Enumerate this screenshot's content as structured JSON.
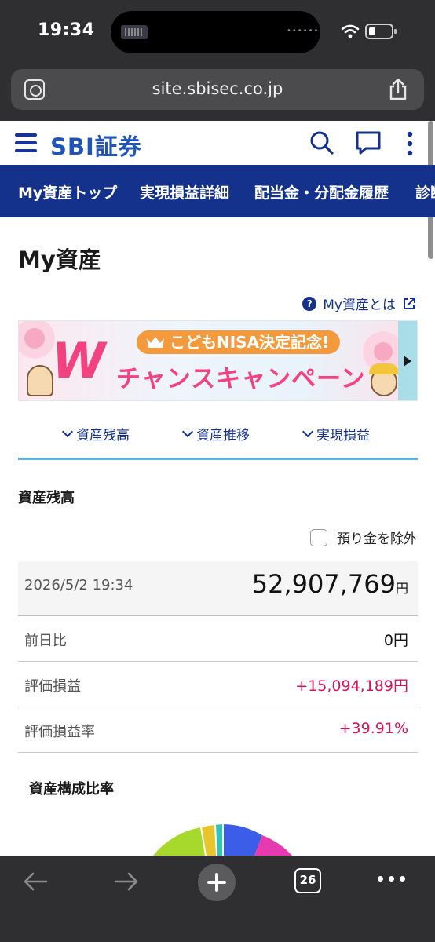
{
  "status": {
    "time": "19:34"
  },
  "browser": {
    "url": "site.sbisec.co.jp",
    "tab_count": "26"
  },
  "header": {
    "logo": "SBI証券"
  },
  "nav": {
    "tabs": [
      "My資産トップ",
      "実現損益詳細",
      "配当金・分配金履歴",
      "診断"
    ]
  },
  "page": {
    "title": "My資産",
    "help_link": "My資産とは"
  },
  "banner": {
    "w_letter": "W",
    "subtitle": "こどもNISA決定記念!",
    "main": "チャンスキャンペーン"
  },
  "anchors": [
    "資産残高",
    "資産推移",
    "実現損益"
  ],
  "balance": {
    "section_title": "資産残高",
    "exclude_label": "預り金を除外",
    "timestamp": "2026/5/2 19:34",
    "total": "52,907,769",
    "total_unit": "円",
    "rows": [
      {
        "label": "前日比",
        "value": "0円"
      },
      {
        "label": "評価損益",
        "value": "+15,094,189円"
      },
      {
        "label": "評価損益率",
        "value": "+39.91%"
      }
    ]
  },
  "composition": {
    "title": "資産構成比率",
    "colors": {
      "blue": "#3b5de7",
      "magenta": "#e83ab0",
      "green": "#a6d92c",
      "yellow": "#e8c52a",
      "teal": "#2fc4b8"
    }
  },
  "colors": {
    "brand": "#14318c",
    "positive": "#d5145a",
    "accent_line": "#63aee0"
  }
}
